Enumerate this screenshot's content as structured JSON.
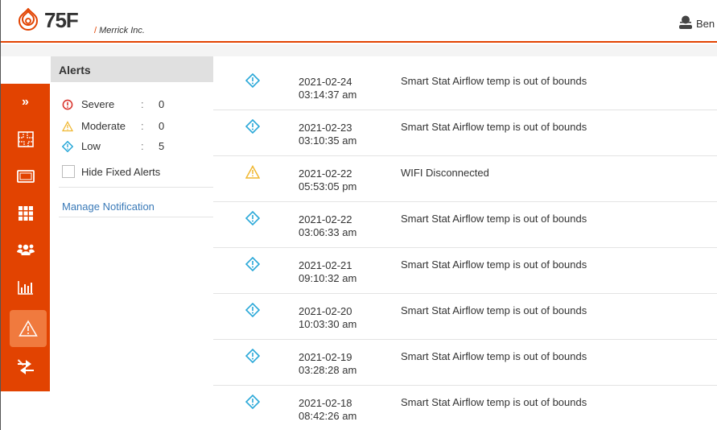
{
  "header": {
    "brand": "75F",
    "org": "Merrick Inc.",
    "user_name": "Ben",
    "accent_color": "#e24301",
    "logo_icon": "75f-logo-icon",
    "user_icon": "user-avatar-icon"
  },
  "sidebar": {
    "expand_label": "»",
    "items": [
      {
        "icon": "floorplan-icon"
      },
      {
        "icon": "display-icon"
      },
      {
        "icon": "grid-apps-icon"
      },
      {
        "icon": "users-group-icon"
      },
      {
        "icon": "bar-chart-icon"
      },
      {
        "icon": "alert-triangle-icon",
        "active": true
      },
      {
        "icon": "transfer-arrows-icon"
      }
    ]
  },
  "alerts_panel": {
    "title": "Alerts",
    "counts": [
      {
        "label": "Severe",
        "value": "0",
        "icon": "severe-circle-icon",
        "color": "#d9362f"
      },
      {
        "label": "Moderate",
        "value": "0",
        "icon": "moderate-triangle-icon",
        "color": "#f0b731"
      },
      {
        "label": "Low",
        "value": "5",
        "icon": "low-diamond-icon",
        "color": "#2aa8d8"
      }
    ],
    "separator": ":",
    "hide_fixed_label": "Hide Fixed Alerts",
    "hide_fixed_checked": false,
    "manage_link": "Manage Notification"
  },
  "alerts": [
    {
      "date": "2021-02-24",
      "time": "03:14:37 am",
      "message": "Smart Stat Airflow temp is out of bounds",
      "severity": "low"
    },
    {
      "date": "2021-02-23",
      "time": "03:10:35 am",
      "message": "Smart Stat Airflow temp is out of bounds",
      "severity": "low"
    },
    {
      "date": "2021-02-22",
      "time": "05:53:05 pm",
      "message": "WIFI Disconnected",
      "severity": "moderate"
    },
    {
      "date": "2021-02-22",
      "time": "03:06:33 am",
      "message": "Smart Stat Airflow temp is out of bounds",
      "severity": "low"
    },
    {
      "date": "2021-02-21",
      "time": "09:10:32 am",
      "message": "Smart Stat Airflow temp is out of bounds",
      "severity": "low"
    },
    {
      "date": "2021-02-20",
      "time": "10:03:30 am",
      "message": "Smart Stat Airflow temp is out of bounds",
      "severity": "low"
    },
    {
      "date": "2021-02-19",
      "time": "03:28:28 am",
      "message": "Smart Stat Airflow temp is out of bounds",
      "severity": "low"
    },
    {
      "date": "2021-02-18",
      "time": "08:42:26 am",
      "message": "Smart Stat Airflow temp is out of bounds",
      "severity": "low"
    }
  ]
}
